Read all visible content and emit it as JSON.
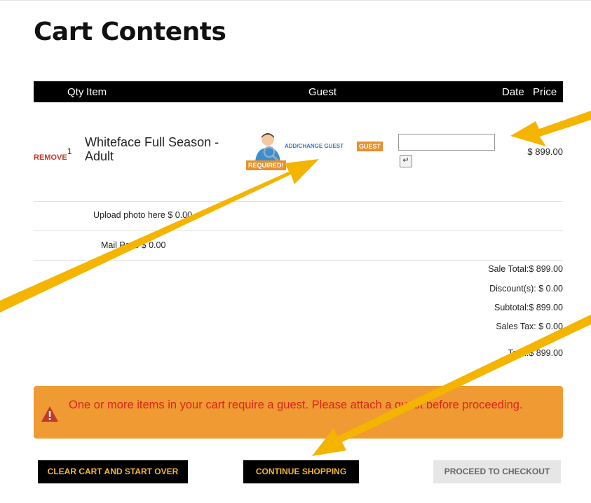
{
  "page": {
    "title": "Cart Contents"
  },
  "table_header": {
    "qty": "Qty",
    "item": "Item",
    "guest": "Guest",
    "date": "Date",
    "price": "Price"
  },
  "cart_item": {
    "remove_label": "REMOVE",
    "qty": "1",
    "name": "Whiteface Full Season - Adult",
    "guest_required_label": "REQUIRED!",
    "add_change_guest_label": "ADD/CHANGE GUEST",
    "guest_tag": "GUEST",
    "date_value": "",
    "enter_symbol": "↵",
    "price": "$ 899.00"
  },
  "extras": [
    {
      "label": "Upload photo here $ 0.00"
    },
    {
      "label": "Mail Pass $ 0.00"
    }
  ],
  "totals": {
    "sale_total": "Sale Total:$ 899.00",
    "discounts": "Discount(s):   $ 0.00",
    "subtotal": "Subtotal:$ 899.00",
    "sales_tax": "Sales Tax:   $ 0.00",
    "total": "Total:$ 899.00"
  },
  "alert": {
    "message": "One or more items in your cart require a guest. Please attach a guest before proceeding.",
    "icon": "warning-icon"
  },
  "buttons": {
    "clear": "CLEAR CART AND START OVER",
    "continue": "CONTINUE SHOPPING",
    "checkout": "PROCEED TO CHECKOUT"
  },
  "colors": {
    "accent_orange": "#ef9a32",
    "arrow_yellow": "#f5b400",
    "alert_text": "#d9261c",
    "header_bg": "#000000"
  }
}
